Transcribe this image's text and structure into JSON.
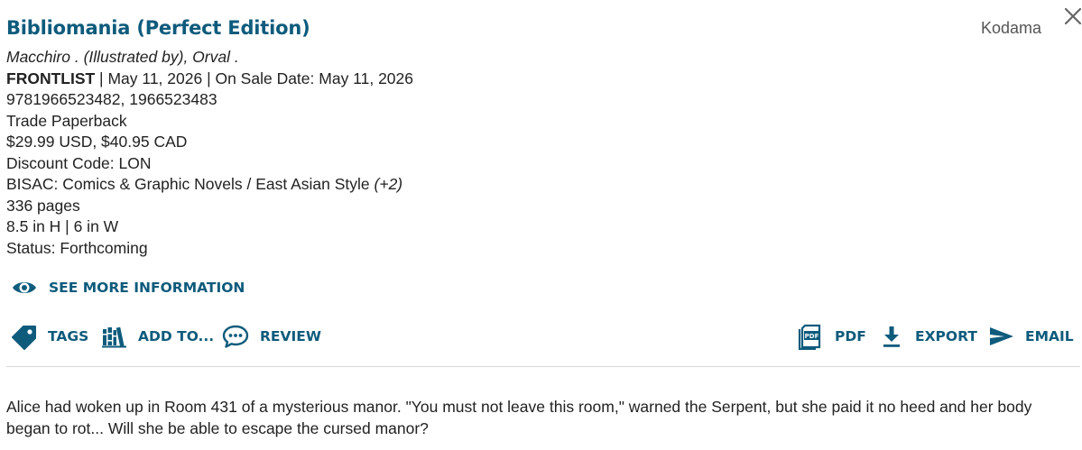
{
  "book": {
    "title": "Bibliomania (Perfect Edition)",
    "publisher": "Kodama",
    "contributors": "Macchiro . (Illustrated by), Orval .",
    "list_label": "FRONTLIST",
    "list_dates": " | May 11, 2026 | On Sale Date: May 11, 2026",
    "isbn": "9781966523482, 1966523483",
    "format": "Trade Paperback",
    "price": "$29.99 USD, $40.95 CAD",
    "discount": "Discount Code: LON",
    "bisac": "BISAC: Comics & Graphic Novels / East Asian Style ",
    "bisac_more": "(+2)",
    "pages": "336 pages",
    "dimensions": "8.5 in H | 6 in W",
    "status": "Status: Forthcoming",
    "description": "Alice had woken up in Room 431 of a mysterious manor. \"You must not leave this room,\" warned the Serpent, but she paid it no heed and her body began to rot... Will she be able to escape the cursed manor?"
  },
  "actions": {
    "see_more": "SEE MORE INFORMATION",
    "tags": "TAGS",
    "add_to": "ADD TO...",
    "review": "REVIEW",
    "pdf": "PDF",
    "pdf_icon_text": "PDF",
    "export": "EXPORT",
    "email": "EMAIL"
  },
  "colors": {
    "accent": "#0e5b7c",
    "text": "#222222",
    "muted": "#555555",
    "divider": "#d8d8d8"
  },
  "icons": [
    "close-icon",
    "eye-icon",
    "tag-icon",
    "books-icon",
    "chat-icon",
    "pdf-icon",
    "download-icon",
    "send-icon"
  ]
}
